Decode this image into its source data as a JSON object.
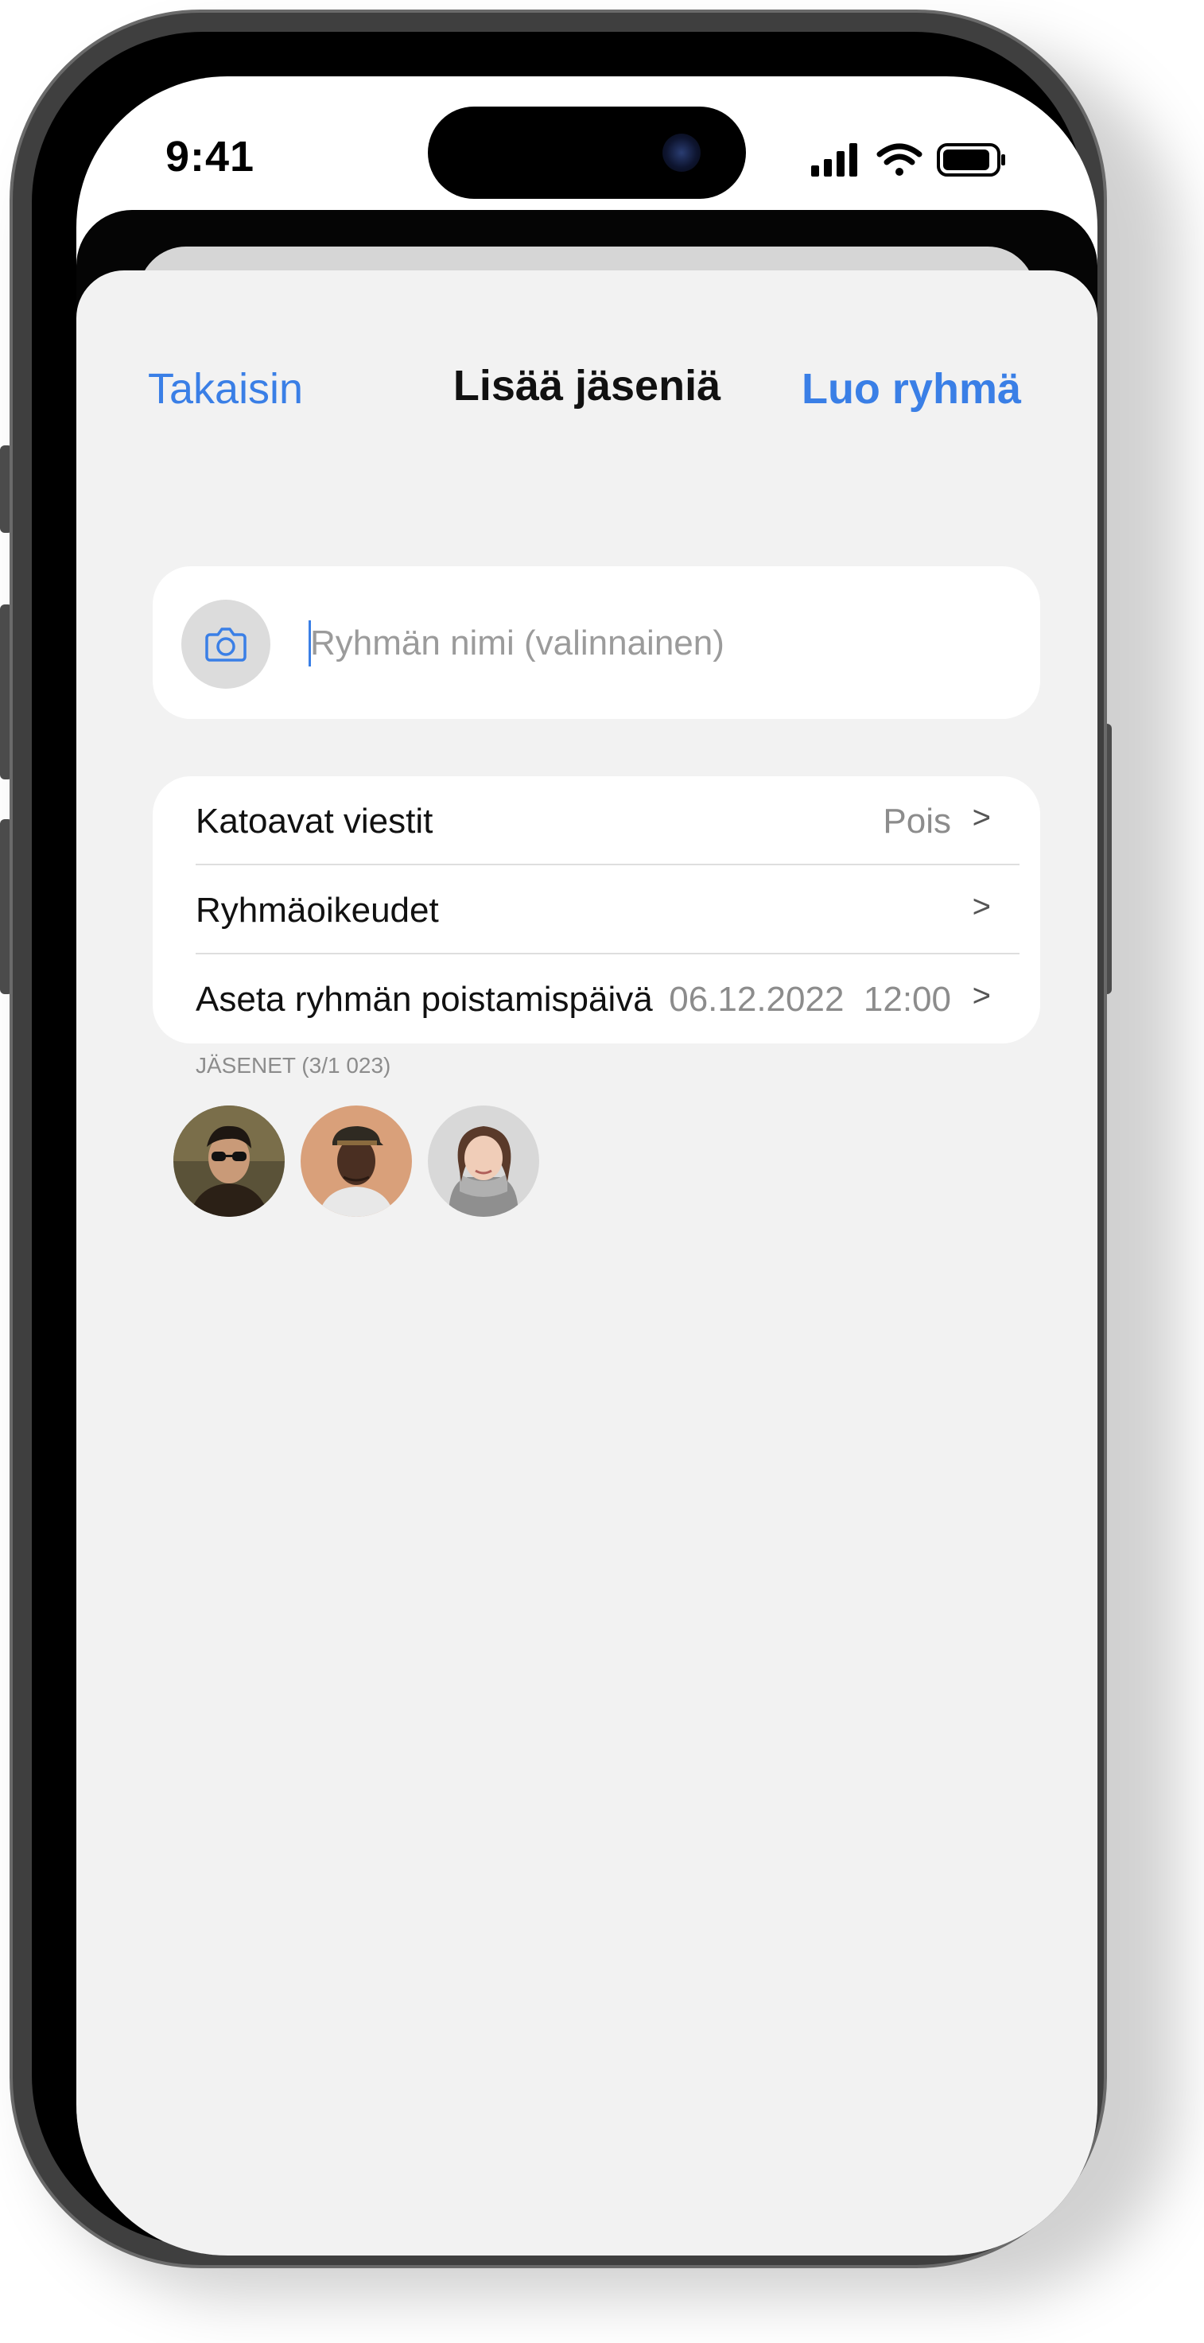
{
  "status_bar": {
    "time": "9:41"
  },
  "nav": {
    "back_label": "Takaisin",
    "title": "Lisää jäseniä",
    "create_label": "Luo ryhmä"
  },
  "group_name": {
    "placeholder": "Ryhmän nimi (valinnainen)",
    "value": ""
  },
  "settings": [
    {
      "label": "Katoavat viestit",
      "value": "Pois",
      "chevron": ">"
    },
    {
      "label": "Ryhmäoikeudet",
      "value": "",
      "chevron": ">"
    },
    {
      "label": "Aseta ryhmän poistamispäivä",
      "value": "06.12.2022  12:00",
      "chevron": ">"
    }
  ],
  "members": {
    "header": "JÄSENET (3/1 023)",
    "avatars": [
      "member-1",
      "member-2",
      "member-3"
    ]
  },
  "colors": {
    "accent": "#3a7fe6",
    "background": "#f2f2f2",
    "card": "#ffffff"
  }
}
